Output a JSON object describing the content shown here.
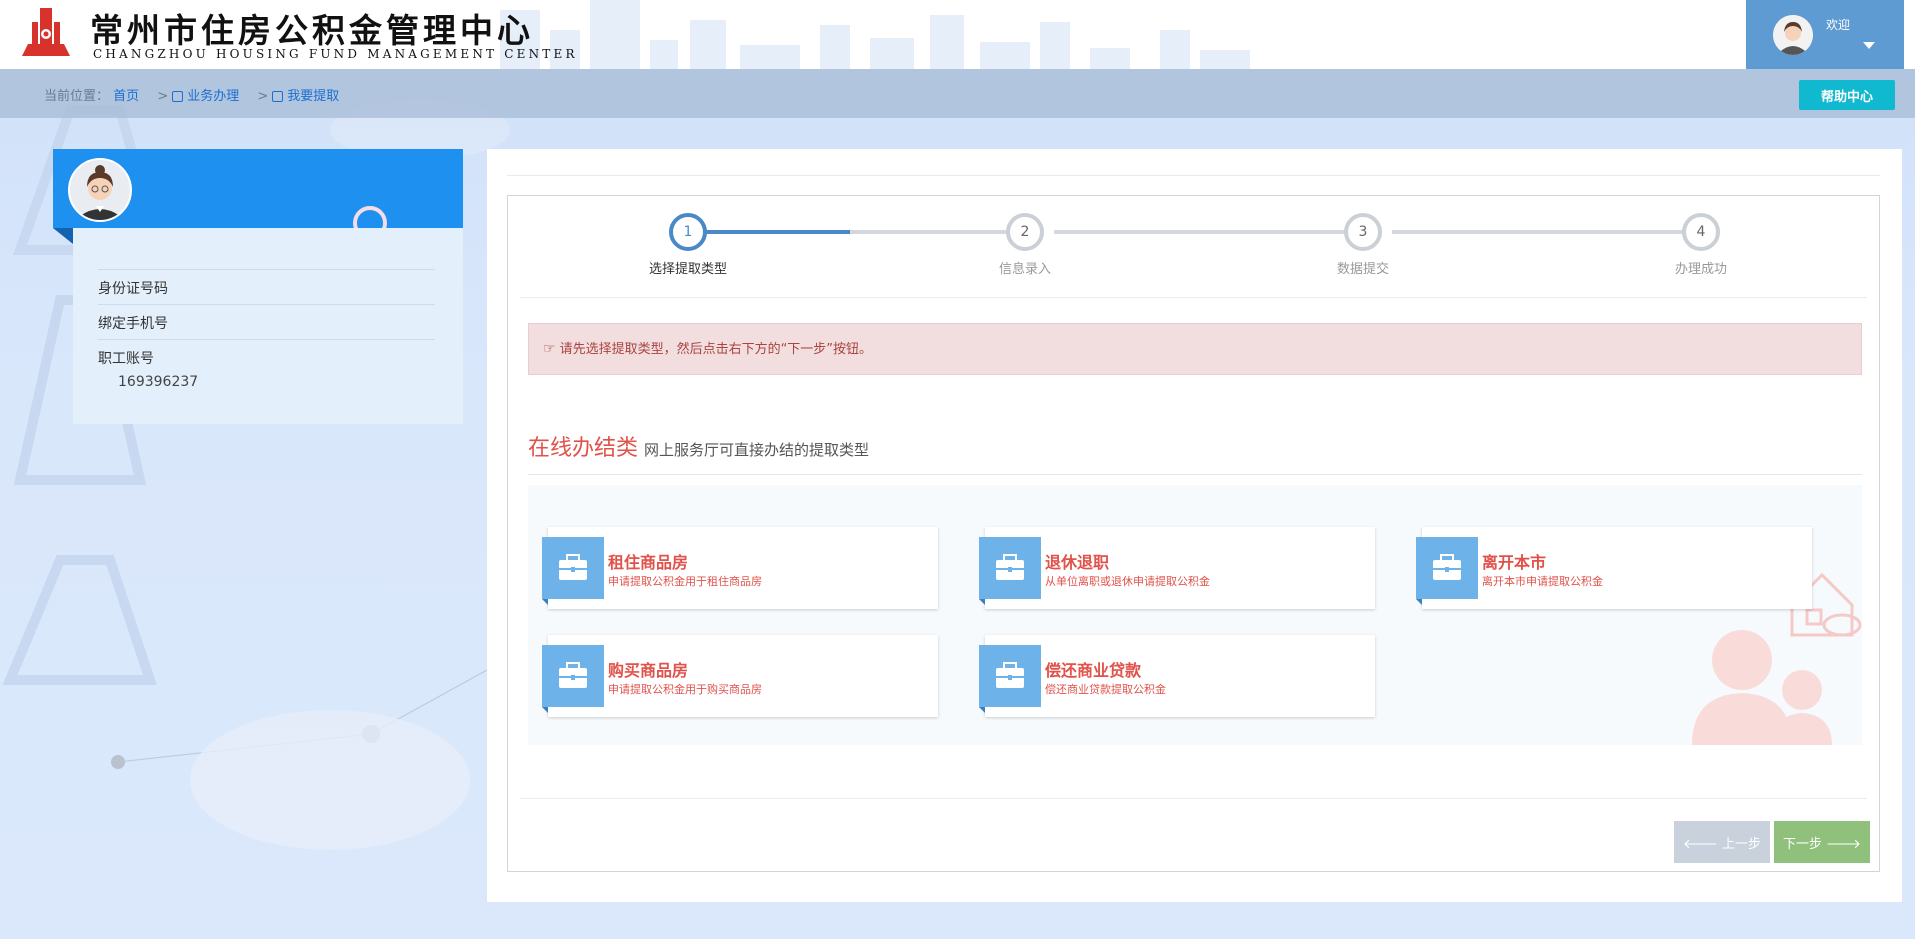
{
  "header": {
    "logo_cn": "常州市住房公积金管理中心",
    "logo_en": "CHANGZHOU HOUSING FUND MANAGEMENT CENTER",
    "welcome": "欢迎"
  },
  "breadcrumb": {
    "prefix": "当前位置：",
    "items": [
      "首页",
      "业务办理",
      "我要提取"
    ]
  },
  "help_button": "帮助中心",
  "profile": {
    "fields": [
      {
        "label": "身份证号码",
        "value": ""
      },
      {
        "label": "绑定手机号",
        "value": ""
      },
      {
        "label": "职工账号",
        "value": "169396237"
      }
    ]
  },
  "steps": [
    {
      "num": "1",
      "label": "选择提取类型",
      "active": true
    },
    {
      "num": "2",
      "label": "信息录入",
      "active": false
    },
    {
      "num": "3",
      "label": "数据提交",
      "active": false
    },
    {
      "num": "4",
      "label": "办理成功",
      "active": false
    }
  ],
  "alert": "请先选择提取类型，然后点击右下方的“下一步”按钮。",
  "section": {
    "title": "在线办结类",
    "subtitle": "网上服务厅可直接办结的提取类型"
  },
  "cards": [
    {
      "title": "租住商品房",
      "desc": "申请提取公积金用于租住商品房"
    },
    {
      "title": "退休退职",
      "desc": "从单位离职或退休申请提取公积金"
    },
    {
      "title": "离开本市",
      "desc": "离开本市申请提取公积金"
    },
    {
      "title": "购买商品房",
      "desc": "申请提取公积金用于购买商品房"
    },
    {
      "title": "偿还商业贷款",
      "desc": "偿还商业贷款提取公积金"
    }
  ],
  "buttons": {
    "prev": "上一步",
    "next": "下一步"
  },
  "colors": {
    "accent_blue": "#1e90ef",
    "help_teal": "#10b9cf",
    "card_red": "#e0524a",
    "next_green": "#8fc17d",
    "prev_gray": "#c9d1dc"
  },
  "icons": [
    "logo-icon",
    "user-avatar-icon",
    "chevron-down-icon",
    "folder-icon",
    "hand-point-icon",
    "briefcase-icon",
    "arrow-left-icon",
    "arrow-right-icon"
  ]
}
